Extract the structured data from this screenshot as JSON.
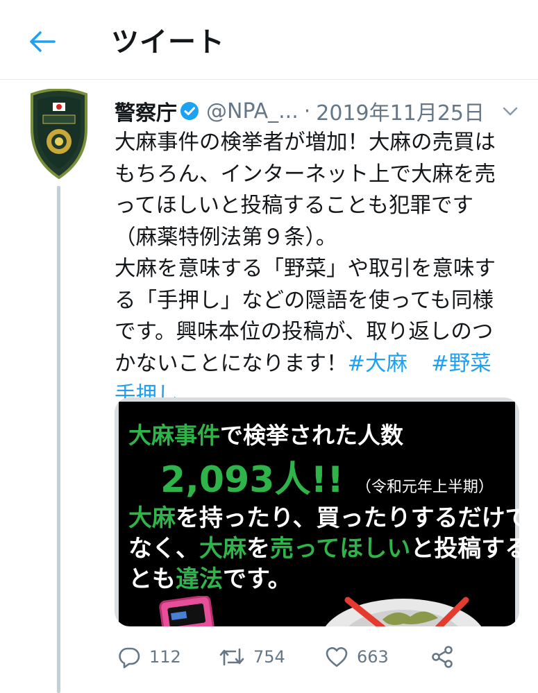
{
  "header": {
    "title": "ツイート"
  },
  "tweet": {
    "name": "警察庁",
    "handle": "@NPA_...",
    "separator": "·",
    "date": "2019年11月25日",
    "lines": [
      "大麻事件の検挙者が増加！大麻の売買は",
      "もちろん、インターネット上で大麻を売",
      "ってほしいと投稿することも犯罪です",
      "（麻薬特例法第９条）。",
      "大麻を意味する「野菜」や取引を意味す",
      "る「手押し」などの隠語を使っても同様",
      "です。興味本位の投稿が、取り返しのつ"
    ],
    "line8_text": "かないことになります！",
    "hashtags": [
      "#大麻",
      "#野菜",
      "手押し"
    ]
  },
  "media": {
    "line1_green": "大麻事件",
    "line1_white": "で検挙された人数",
    "count": "2,093人!!",
    "period": "（令和元年上半期）",
    "line3_green": "大麻",
    "line3_white": "を持ったり、買ったりするだけで",
    "line4_a": "なく、",
    "line4_green1": "大麻",
    "line4_b": "を",
    "line4_green2": "売ってほしい",
    "line4_c": "と投稿するこ",
    "line5_a": "とも",
    "line5_green": "違法",
    "line5_b": "です。"
  },
  "actions": {
    "reply_count": "112",
    "retweet_count": "754",
    "like_count": "663"
  },
  "colors": {
    "accent": "#1da1f2",
    "muted": "#657786",
    "green": "#2fb44a"
  },
  "icons": {
    "back": "arrow-left-icon",
    "verified": "verified-badge-icon",
    "caret": "chevron-down-icon",
    "reply": "reply-icon",
    "retweet": "retweet-icon",
    "like": "heart-icon",
    "share": "share-icon"
  }
}
